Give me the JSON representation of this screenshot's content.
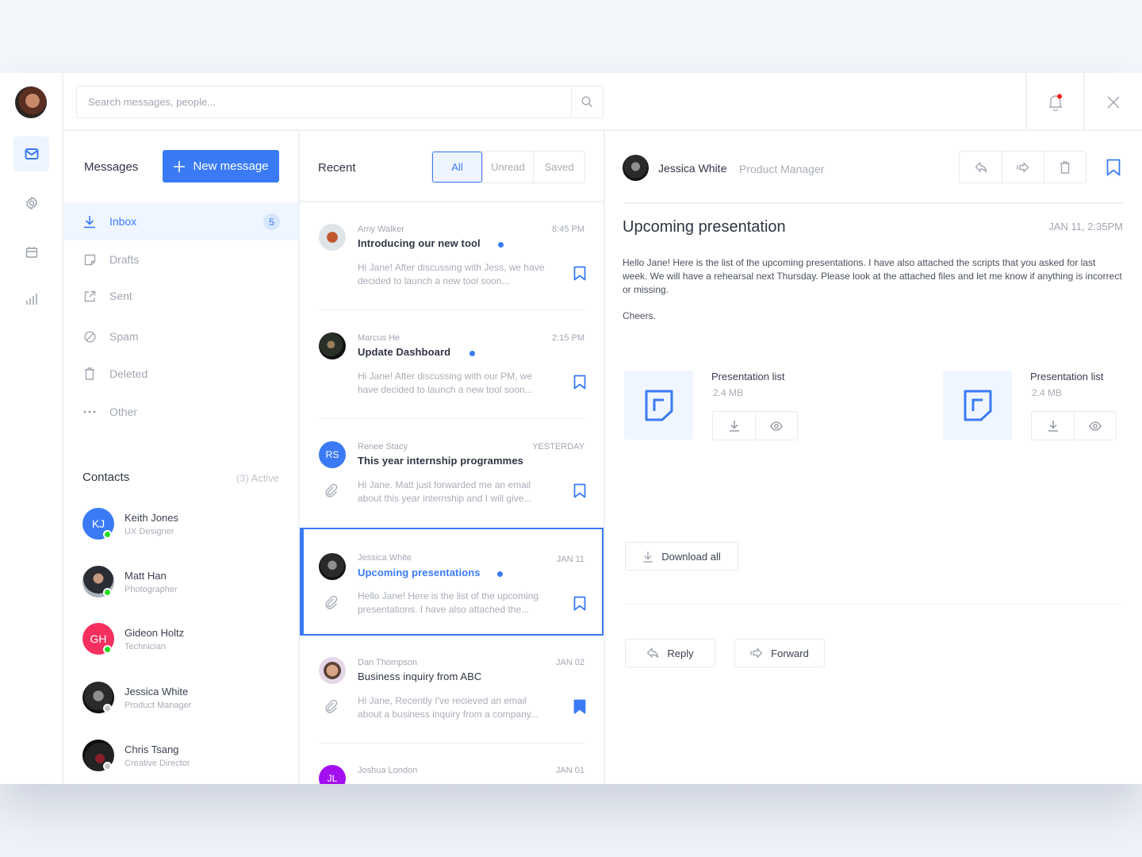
{
  "search": {
    "placeholder": "Search messages, people..."
  },
  "rail": {
    "items": [
      {
        "name": "mail",
        "icon": "mail-icon",
        "active": true
      },
      {
        "name": "settings",
        "icon": "gear-icon",
        "active": false
      },
      {
        "name": "calendar",
        "icon": "calendar-icon",
        "active": false
      },
      {
        "name": "stats",
        "icon": "bar-chart-icon",
        "active": false
      }
    ]
  },
  "header": {
    "notifications_icon": "bell-icon",
    "has_notification": true,
    "close_icon": "close-icon"
  },
  "folders": {
    "title": "Messages",
    "new_message_label": "New message",
    "items": [
      {
        "label": "Inbox",
        "icon": "inbox-download-icon",
        "badge": "5",
        "active": true
      },
      {
        "label": "Drafts",
        "icon": "draft-note-icon"
      },
      {
        "label": "Sent",
        "icon": "external-link-icon"
      },
      {
        "label": "Spam",
        "icon": "block-icon"
      },
      {
        "label": "Deleted",
        "icon": "trash-icon"
      },
      {
        "label": "Other",
        "icon": "more-dots-icon"
      }
    ]
  },
  "contacts": {
    "title": "Contacts",
    "active_label": "(3) Active",
    "items": [
      {
        "name": "Keith Jones",
        "role": "UX Designer",
        "initials": "KJ",
        "color": "#3a7bf5",
        "online": true
      },
      {
        "name": "Matt Han",
        "role": "Photographer",
        "initials": "",
        "online": true
      },
      {
        "name": "Gideon Holtz",
        "role": "Technician",
        "initials": "GH",
        "color": "#f5305f",
        "online": true
      },
      {
        "name": "Jessica White",
        "role": "Product Manager",
        "initials": "",
        "online": false
      },
      {
        "name": "Chris Tsang",
        "role": "Creative Director",
        "initials": "",
        "online": false
      }
    ]
  },
  "list": {
    "title": "Recent",
    "filters": [
      {
        "label": "All",
        "active": true
      },
      {
        "label": "Unread"
      },
      {
        "label": "Saved"
      }
    ],
    "messages": [
      {
        "from": "Amy Walker",
        "time": "8:45 PM",
        "subject": "Introducing our new tool",
        "unread": true,
        "preview": "Hi Jane! After discussing with Jess, we have decided to launch a new tool soon...",
        "attachment": false,
        "saved": false
      },
      {
        "from": "Marcus He",
        "time": "2:15 PM",
        "subject": "Update Dashboard",
        "unread": true,
        "preview": "Hi Jane! After discussing with our PM, we have decided to launch a new tool soon...",
        "attachment": false,
        "saved": false
      },
      {
        "from": "Renee Stacy",
        "time": "YESTERDAY",
        "subject": "This year internship programmes",
        "unread": false,
        "initials": "RS",
        "preview": "Hi Jane. Matt just forwarded me an email about this year internship and I will give...",
        "attachment": true,
        "saved": false
      },
      {
        "from": "Jessica White",
        "time": "JAN 11",
        "subject": "Upcoming presentations",
        "unread": true,
        "selected": true,
        "preview": "Hello Jane! Here is the list of the upcoming presentations. I have also attached the...",
        "attachment": true,
        "saved": false
      },
      {
        "from": "Dan Thompson",
        "time": "JAN 02",
        "subject": "Business inquiry from ABC",
        "unread": false,
        "preview": "Hi Jane, Recently I've recieved an email about a business inquiry from a company...",
        "attachment": true,
        "saved": true
      },
      {
        "from": "Joshua London",
        "time": "JAN 01",
        "initials": "JL"
      }
    ]
  },
  "reader": {
    "sender_name": "Jessica White",
    "sender_role": "Product Manager",
    "subject": "Upcoming presentation",
    "date": "JAN 11, 2:35PM",
    "body": [
      "Hello Jane! Here is the list of the upcoming presentations. I have also attached the scripts that you asked for last week. We will have a rehearsal next Thursday. Please look at the attached files and let me know if anything is incorrect or missing.",
      "Cheers."
    ],
    "attachments": [
      {
        "name": "Presentation list",
        "size": "2.4 MB"
      },
      {
        "name": "Presentation list",
        "size": "2.4 MB"
      }
    ],
    "download_all_label": "Download all",
    "reply_label": "Reply",
    "forward_label": "Forward"
  },
  "colors": {
    "accent": "#3a7bf5",
    "online": "#22dd22",
    "offline": "#c4c4c4",
    "notification": "#ff1a1a"
  }
}
